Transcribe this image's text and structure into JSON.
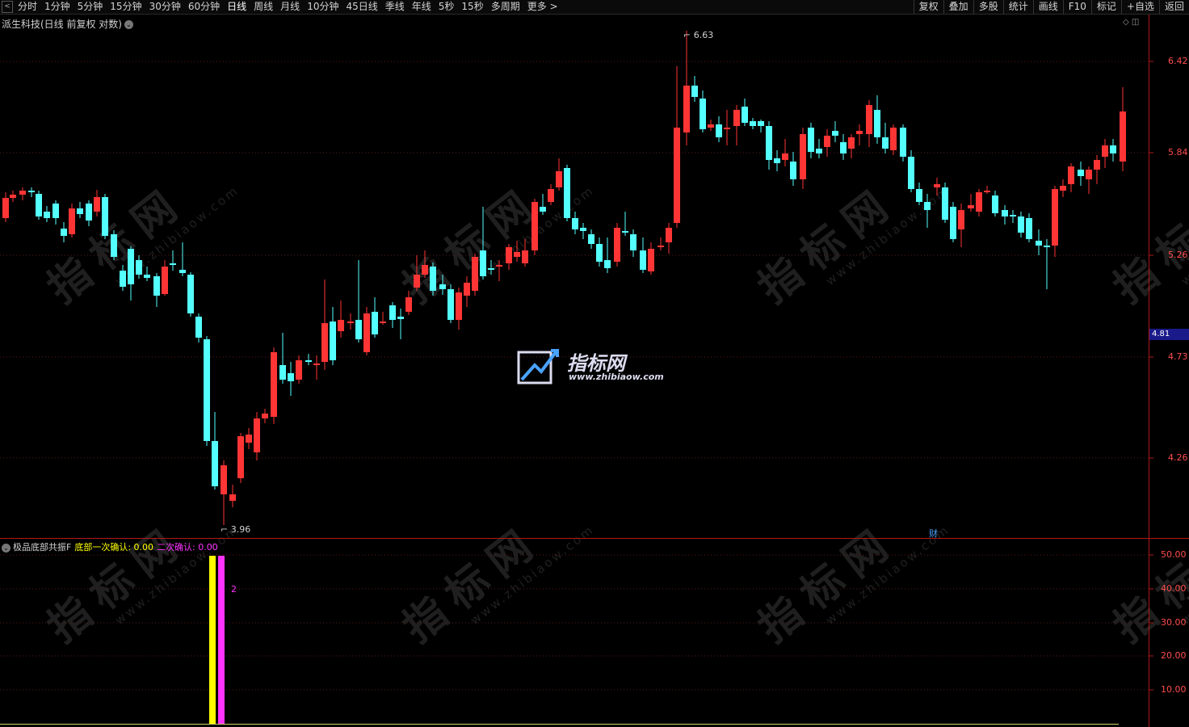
{
  "toolbar": {
    "nav_back": "<",
    "periods": [
      "分时",
      "1分钟",
      "5分钟",
      "15分钟",
      "30分钟",
      "60分钟",
      "日线",
      "周线",
      "月线",
      "10分钟",
      "45日线",
      "季线",
      "年线",
      "5秒",
      "15秒",
      "多周期",
      "更多 >"
    ],
    "active_period": "日线",
    "tools": [
      "复权",
      "叠加",
      "多股",
      "统计",
      "画线",
      "F10",
      "标记",
      "+自选",
      "返回"
    ]
  },
  "chart": {
    "title": "派生科技(日线 前复权 对数)",
    "top_icons": "◇ ◫",
    "price_axis": [
      "6.42",
      "5.84",
      "5.26",
      "4.73",
      "4.26"
    ],
    "current_price": "4.81",
    "high_label": "6.63",
    "low_label": "3.96",
    "financial_marker": "财",
    "up_color": "#ff3535",
    "down_color": "#54ffff"
  },
  "indicator": {
    "name": "极品底部共振F",
    "line1": "底部一次确认: 0.00",
    "line2": "二次确认: 0.00",
    "bar_label": "2",
    "axis": [
      "50.00",
      "40.00",
      "30.00",
      "20.00",
      "10.00"
    ],
    "line1_color": "#ffff00",
    "line2_color": "#ff33ff"
  },
  "watermark": {
    "text": "指标网",
    "url": "www.zhibiaow.com"
  }
}
